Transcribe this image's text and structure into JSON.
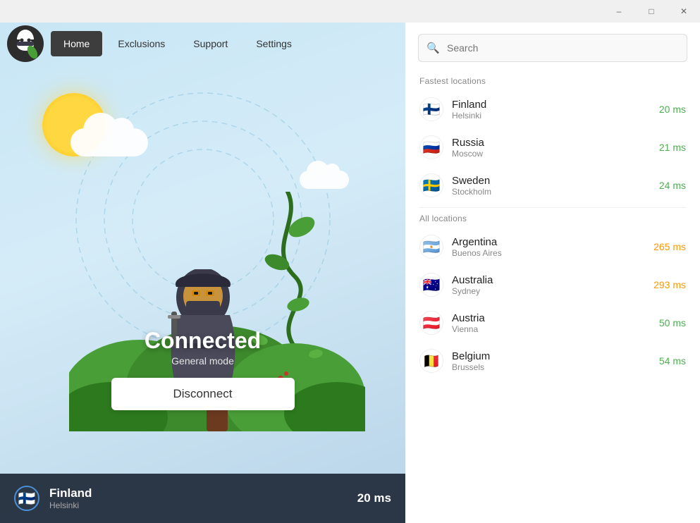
{
  "titlebar": {
    "minimize_label": "–",
    "maximize_label": "□",
    "close_label": "✕"
  },
  "nav": {
    "home_label": "Home",
    "exclusions_label": "Exclusions",
    "support_label": "Support",
    "settings_label": "Settings"
  },
  "hero": {
    "status": "Connected",
    "mode": "General mode",
    "disconnect_label": "Disconnect"
  },
  "bottom_bar": {
    "country": "Finland",
    "city": "Helsinki",
    "ping": "20 ms",
    "flag": "🇫🇮"
  },
  "search": {
    "placeholder": "Search"
  },
  "fastest_section": {
    "label": "Fastest locations"
  },
  "all_section": {
    "label": "All locations"
  },
  "fastest_locations": [
    {
      "country": "Finland",
      "city": "Helsinki",
      "ping": "20 ms",
      "ping_class": "ping-fast",
      "flag": "🇫🇮"
    },
    {
      "country": "Russia",
      "city": "Moscow",
      "ping": "21 ms",
      "ping_class": "ping-fast",
      "flag": "🇷🇺"
    },
    {
      "country": "Sweden",
      "city": "Stockholm",
      "ping": "24 ms",
      "ping_class": "ping-fast",
      "flag": "🇸🇪"
    }
  ],
  "all_locations": [
    {
      "country": "Argentina",
      "city": "Buenos Aires",
      "ping": "265 ms",
      "ping_class": "ping-medium",
      "flag": "🇦🇷"
    },
    {
      "country": "Australia",
      "city": "Sydney",
      "ping": "293 ms",
      "ping_class": "ping-medium",
      "flag": "🇦🇺"
    },
    {
      "country": "Austria",
      "city": "Vienna",
      "ping": "50 ms",
      "ping_class": "ping-fast",
      "flag": "🇦🇹"
    },
    {
      "country": "Belgium",
      "city": "Brussels",
      "ping": "54 ms",
      "ping_class": "ping-fast",
      "flag": "🇧🇪"
    }
  ]
}
